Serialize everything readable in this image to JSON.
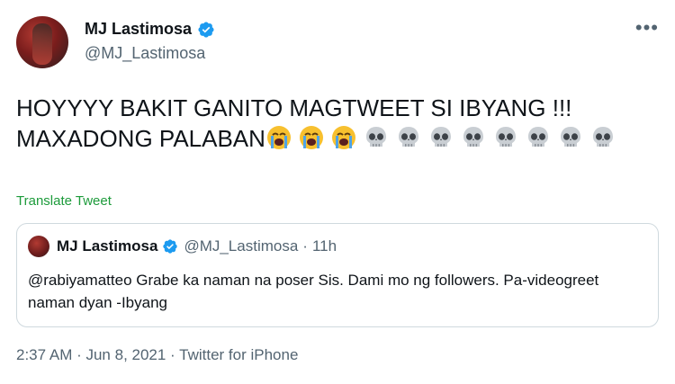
{
  "author": {
    "display_name": "MJ Lastimosa",
    "handle": "@MJ_Lastimosa",
    "verified_icon": "verified-badge-icon"
  },
  "more_label": "•••",
  "tweet": {
    "line1": "HOYYYY BAKIT GANITO MAGTWEET SI IBYANG !!!",
    "line2_text": "MAXADONG PALABAN",
    "emojis_crying": 3,
    "emojis_skull": 8,
    "emoji_names": [
      "loudly-crying-face",
      "skull"
    ]
  },
  "translate_label": "Translate Tweet",
  "quoted": {
    "display_name": "MJ Lastimosa",
    "handle": "@MJ_Lastimosa",
    "separator": "·",
    "time": "11h",
    "text": "@rabiyamatteo Grabe ka naman na poser Sis. Dami mo ng followers. Pa-videogreet naman dyan -Ibyang"
  },
  "footer": {
    "text": "2:37 AM · Jun 8, 2021 · Twitter for iPhone"
  },
  "colors": {
    "text": "#0f1419",
    "secondary": "#536471",
    "verified": "#1d9bf0",
    "translate": "#1d9b3b",
    "border": "#cfd9de"
  }
}
